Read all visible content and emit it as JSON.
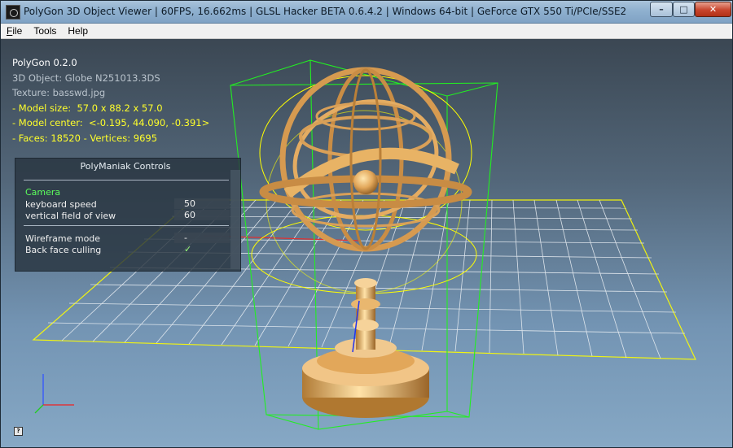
{
  "window": {
    "title": "PolyGon 3D Object Viewer | 60FPS, 16.662ms | GLSL Hacker BETA 0.6.4.2 | Windows 64-bit | GeForce GTX 550 Ti/PCIe/SSE2",
    "minimize_label": "–",
    "maximize_label": "□",
    "close_label": "✕"
  },
  "menu": {
    "file": {
      "underline": "F",
      "rest": "ile"
    },
    "tools": "Tools",
    "help": "Help"
  },
  "info": {
    "app_name": "PolyGon 0.2.0",
    "object": "3D Object: Globe N251013.3DS",
    "texture": "Texture: basswd.jpg",
    "model_size": "- Model size:  57.0 x 88.2 x 57.0",
    "model_center": "- Model center:  <-0.195, 44.090, -0.391>",
    "faces_vertices": "- Faces: 18520 - Vertices: 9695"
  },
  "controls": {
    "title": "PolyManiak Controls",
    "camera_header": "Camera",
    "keyboard_speed_label": "keyboard speed",
    "keyboard_speed_value": "50",
    "fov_label": "vertical field of view",
    "fov_value": "60",
    "wireframe_label": "Wireframe mode",
    "wireframe_value": "-",
    "backface_label": "Back face culling",
    "backface_value": "✓"
  },
  "help_button": "?",
  "colors": {
    "grid_plane": "#ffff00",
    "bounding_box": "#22ee22",
    "model": "#e8b060",
    "info_highlight": "#ffff2b",
    "camera_header": "#5cff5c"
  }
}
